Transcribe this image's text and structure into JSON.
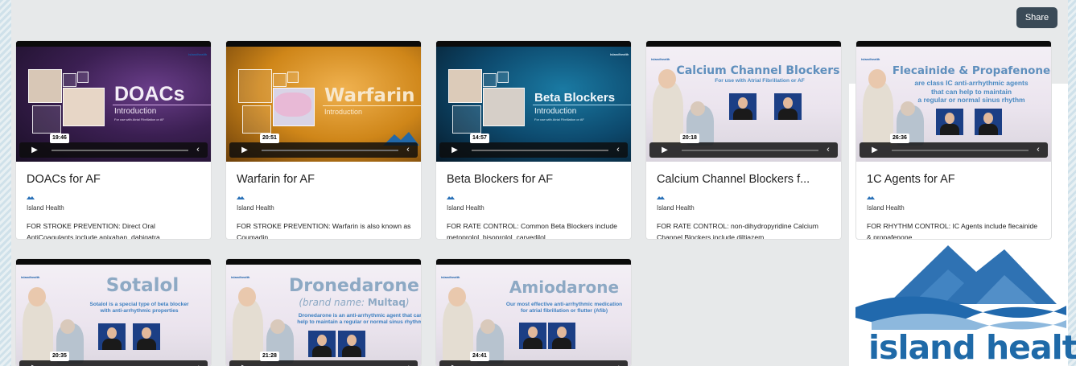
{
  "toolbar": {
    "share_label": "Share"
  },
  "org": {
    "name": "Island Health",
    "watermark_text": "island health",
    "brand_blue": "#1f6aa8"
  },
  "videos": [
    {
      "thumb_title": "DOACs",
      "thumb_subtitle": "Introduction",
      "thumb_caption": "For use with Atrial Fibrillation or AF",
      "duration": "19:46",
      "title": "DOACs for AF",
      "org": "Island Health",
      "description": "FOR STROKE PREVENTION: Direct Oral AntiCoagulants include apixaban, dabigatra..."
    },
    {
      "thumb_title": "Warfarin",
      "thumb_subtitle": "Introduction",
      "duration": "20:51",
      "title": "Warfarin for AF",
      "org": "Island Health",
      "description": "FOR STROKE PREVENTION: Warfarin is also known as Coumadin."
    },
    {
      "thumb_title": "Beta Blockers",
      "thumb_subtitle": "Introduction",
      "thumb_caption": "For use with Atrial Fibrillation or AF",
      "duration": "14:57",
      "title": "Beta Blockers for AF",
      "org": "Island Health",
      "description": "FOR RATE CONTROL: Common Beta Blockers include metoprolol, bisoprolol, carvedilol."
    },
    {
      "thumb_title": "Calcium Channel Blockers",
      "thumb_subtitle": "For use with Atrial Fibrillation or AF",
      "duration": "20:18",
      "title": "Calcium Channel Blockers f...",
      "org": "Island Health",
      "description": "FOR RATE CONTROL: non-dihydropyridine Calcium Channel Blockers include diltiazem ..."
    },
    {
      "thumb_title": "Flecainide & Propafenone",
      "thumb_subtitle_lines": [
        "are class IC anti-arrhythmic agents",
        "that can help to maintain",
        "a regular or normal sinus rhythm"
      ],
      "duration": "26:36",
      "title": "1C Agents for AF",
      "org": "Island Health",
      "description": "FOR RHYTHM CONTROL: IC Agents include flecainide & propafenone."
    },
    {
      "thumb_title": "Sotalol",
      "thumb_subtitle_lines": [
        "Sotalol is a special type of beta blocker",
        "with anti-arrhythmic properties"
      ],
      "duration": "20:35"
    },
    {
      "thumb_title": "Dronedarone",
      "thumb_brand_prefix": "(brand name: ",
      "thumb_brand_name": "Multaq",
      "thumb_brand_suffix": ")",
      "thumb_subtitle_lines": [
        "Dronedarone is an anti-arrhythmic agent that can",
        "help to maintain a regular or normal sinus rhythm."
      ],
      "duration": "21:28"
    },
    {
      "thumb_title": "Amiodarone",
      "thumb_subtitle_lines": [
        "Our most effective anti-arrhythmic medication",
        "for atrial fibrillation or flutter (Afib)"
      ],
      "duration": "24:41"
    }
  ],
  "thumb_logo_text": "islandhealth",
  "controls": {
    "play_icon": "play-icon",
    "collapse_icon": "chevron-left-icon"
  }
}
